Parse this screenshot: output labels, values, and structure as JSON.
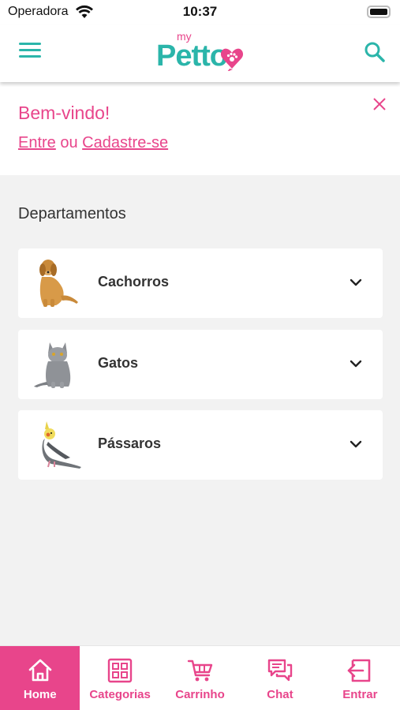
{
  "status_bar": {
    "carrier": "Operadora",
    "time": "10:37"
  },
  "header": {
    "logo_small": "my",
    "logo_main": "Petto"
  },
  "welcome": {
    "title": "Bem-vindo!",
    "login_link": "Entre",
    "or_text": " ou ",
    "signup_link": "Cadastre-se"
  },
  "departments": {
    "title": "Departamentos",
    "items": [
      {
        "label": "Cachorros",
        "image": "dog"
      },
      {
        "label": "Gatos",
        "image": "cat"
      },
      {
        "label": "Pássaros",
        "image": "bird"
      }
    ]
  },
  "tabs": [
    {
      "label": "Home",
      "icon": "home-icon",
      "active": true
    },
    {
      "label": "Categorias",
      "icon": "grid-icon"
    },
    {
      "label": "Carrinho",
      "icon": "cart-icon"
    },
    {
      "label": "Chat",
      "icon": "chat-icon"
    },
    {
      "label": "Entrar",
      "icon": "login-icon"
    }
  ],
  "colors": {
    "brand_pink": "#e8458b",
    "brand_teal": "#2bb5aa",
    "background": "#f2f2f2"
  }
}
